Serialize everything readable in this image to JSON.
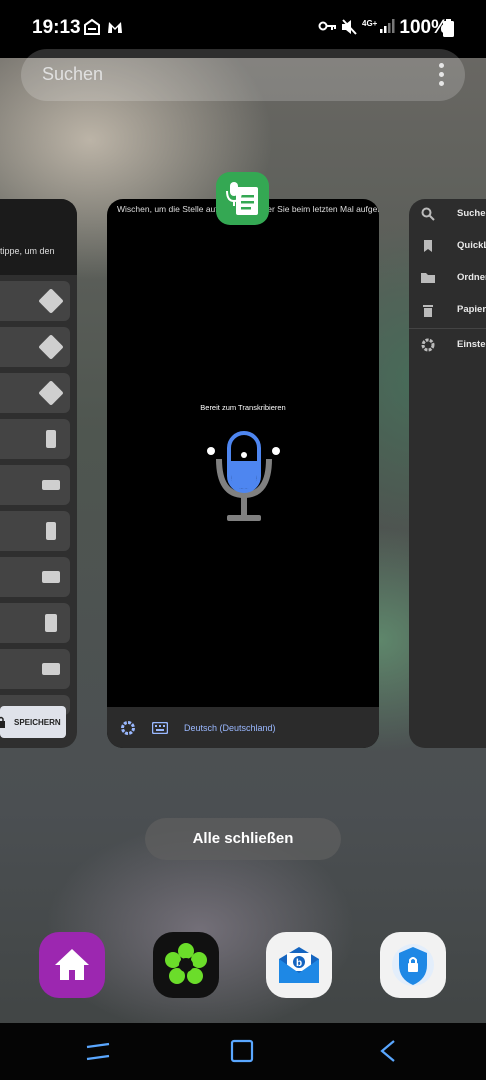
{
  "status_bar": {
    "time": "19:13",
    "battery": "100%",
    "network": "4G+",
    "left_icons": [
      "inbox-icon",
      "malwarebytes-icon"
    ],
    "right_icons": [
      "vpn-key-icon",
      "mute-icon",
      "signal-icon",
      "battery-icon"
    ]
  },
  "search": {
    "placeholder": "Suchen"
  },
  "left_card": {
    "hint": "tippe, um den",
    "save_label": "SPEICHERN"
  },
  "center_card": {
    "hint": "Wischen, um die Stelle aufzurufen, an der Sie beim letzten Mal aufgehört hast",
    "status": "Bereit zum Transkribieren",
    "language": "Deutsch (Deutschland)",
    "mic_color": "#4e86f0"
  },
  "right_card": {
    "items": [
      {
        "icon": "search-icon",
        "label": "Suche"
      },
      {
        "icon": "bookmark-icon",
        "label": "QuickL"
      },
      {
        "icon": "folder-icon",
        "label": "Ordner"
      },
      {
        "icon": "trash-icon",
        "label": "Papier"
      },
      {
        "icon": "settings-icon",
        "label": "Einstel"
      }
    ]
  },
  "close_all": "Alle schließen",
  "dock": [
    {
      "name": "home-app",
      "color": "#9c27b0"
    },
    {
      "name": "icq-app",
      "color": "#111111"
    },
    {
      "name": "bluemail-app",
      "color": "#1565c0"
    },
    {
      "name": "vpn-shield-app",
      "color": "#1976d2"
    }
  ]
}
